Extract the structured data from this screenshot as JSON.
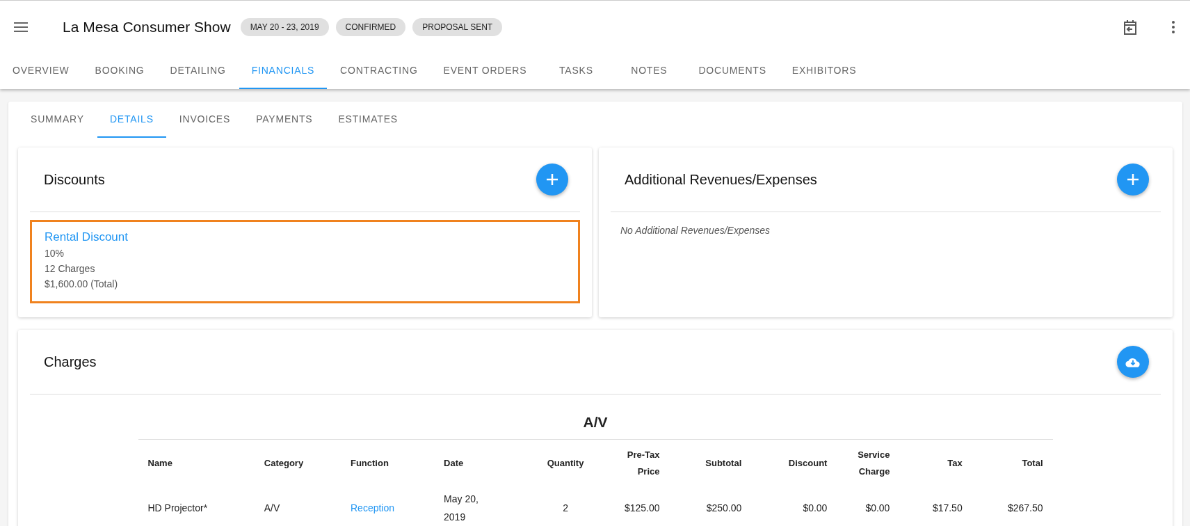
{
  "header": {
    "title": "La Mesa Consumer Show",
    "chips": [
      "MAY 20 - 23, 2019",
      "CONFIRMED",
      "PROPOSAL SENT"
    ]
  },
  "tabs": [
    {
      "label": "OVERVIEW",
      "selected": false
    },
    {
      "label": "BOOKING",
      "selected": false
    },
    {
      "label": "DETAILING",
      "selected": false
    },
    {
      "label": "FINANCIALS",
      "selected": true
    },
    {
      "label": "CONTRACTING",
      "selected": false
    },
    {
      "label": "EVENT ORDERS",
      "selected": false
    },
    {
      "label": "TASKS",
      "selected": false
    },
    {
      "label": "NOTES",
      "selected": false
    },
    {
      "label": "DOCUMENTS",
      "selected": false
    },
    {
      "label": "EXHIBITORS",
      "selected": false
    }
  ],
  "subtabs": [
    {
      "label": "SUMMARY",
      "selected": false
    },
    {
      "label": "DETAILS",
      "selected": true
    },
    {
      "label": "INVOICES",
      "selected": false
    },
    {
      "label": "PAYMENTS",
      "selected": false
    },
    {
      "label": "ESTIMATES",
      "selected": false
    }
  ],
  "discounts": {
    "title": "Discounts",
    "items": [
      {
        "name": "Rental Discount",
        "selected": true,
        "lines": [
          "10%",
          "12 Charges",
          "$1,600.00 (Total)"
        ]
      }
    ]
  },
  "revenues": {
    "title": "Additional Revenues/Expenses",
    "empty": "No Additional Revenues/Expenses"
  },
  "charges": {
    "title": "Charges",
    "group": "A/V",
    "columns": [
      "Name",
      "Category",
      "Function",
      "Date",
      "Quantity",
      "Pre-Tax Price",
      "Subtotal",
      "Discount",
      "Service Charge",
      "Tax",
      "Total"
    ],
    "rows": [
      {
        "cells": [
          "HD Projector*",
          "A/V",
          "Reception",
          "May 20, 2019",
          "2",
          "$125.00",
          "$250.00",
          "$0.00",
          "$0.00",
          "$17.50",
          "$267.50"
        ]
      }
    ]
  }
}
